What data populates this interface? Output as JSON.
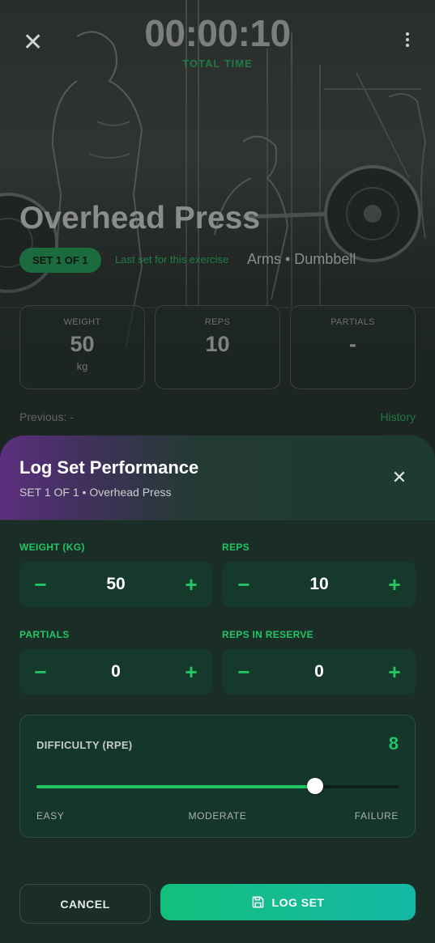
{
  "workout": {
    "timer": "00:00:10",
    "timer_label": "TOTAL TIME",
    "exercise_title": "Overhead Press",
    "set_badge": "SET 1 OF 1",
    "last_set_note": "Last set for this exercise",
    "meta": "Arms • Dumbbell",
    "stats": [
      {
        "label": "WEIGHT",
        "value": "50",
        "unit": "kg"
      },
      {
        "label": "REPS",
        "value": "10",
        "unit": ""
      },
      {
        "label": "PARTIALS",
        "value": "-",
        "unit": ""
      }
    ],
    "previous": "Previous: -",
    "history_link": "History"
  },
  "sheet": {
    "title": "Log Set Performance",
    "subtitle": "SET 1 OF 1 • Overhead Press",
    "close_icon": "close-icon",
    "fields": [
      {
        "label": "WEIGHT (KG)",
        "value": "50"
      },
      {
        "label": "REPS",
        "value": "10"
      },
      {
        "label": "PARTIALS",
        "value": "0"
      },
      {
        "label": "REPS IN RESERVE",
        "value": "0"
      }
    ],
    "rpe": {
      "label": "DIFFICULTY (RPE)",
      "value": "8",
      "fraction": 0.77,
      "ticks": [
        "EASY",
        "MODERATE",
        "FAILURE"
      ]
    },
    "cancel_label": "CANCEL",
    "log_label": "LOG SET",
    "accent_color": "#22c564",
    "button_gradient": [
      "#13bf7c",
      "#14b8a6"
    ]
  }
}
